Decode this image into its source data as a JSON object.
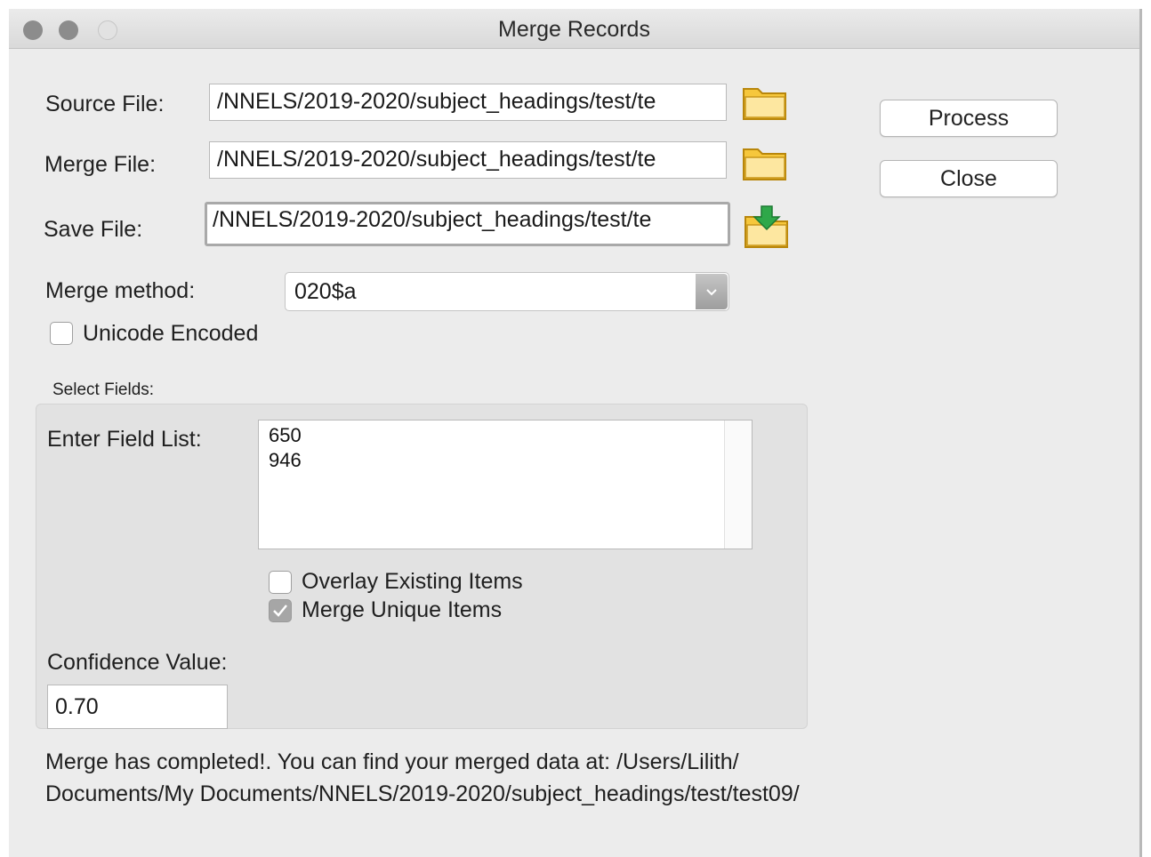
{
  "window": {
    "title": "Merge Records"
  },
  "files": {
    "source_label": "Source File:",
    "source_value": "/NNELS/2019-2020/subject_headings/test/te",
    "merge_label": "Merge File:",
    "merge_value": "/NNELS/2019-2020/subject_headings/test/te",
    "save_label": "Save File:",
    "save_value": "/NNELS/2019-2020/subject_headings/test/te"
  },
  "buttons": {
    "process": "Process",
    "close": "Close"
  },
  "method": {
    "label": "Merge method:",
    "value": "020$a"
  },
  "unicode": {
    "label": "Unicode Encoded",
    "checked": false
  },
  "select_fields": {
    "heading": "Select Fields:",
    "field_list_label": "Enter Field List:",
    "field_list_lines": [
      "650",
      "946"
    ],
    "overlay_label": "Overlay Existing Items",
    "overlay_checked": false,
    "merge_unique_label": "Merge Unique Items",
    "merge_unique_checked": true,
    "confidence_label": "Confidence Value:",
    "confidence_value": "0.70"
  },
  "status": {
    "line1": "Merge has completed!.  You can find your merged data at: /Users/Lilith/",
    "line2": "Documents/My Documents/NNELS/2019-2020/subject_headings/test/test09/"
  },
  "icons": {
    "folder": "folder-icon",
    "save": "save-folder-icon"
  },
  "colors": {
    "window_bg": "#ececec",
    "folder": "#f2b91f",
    "save_arrow": "#2fa84a"
  }
}
